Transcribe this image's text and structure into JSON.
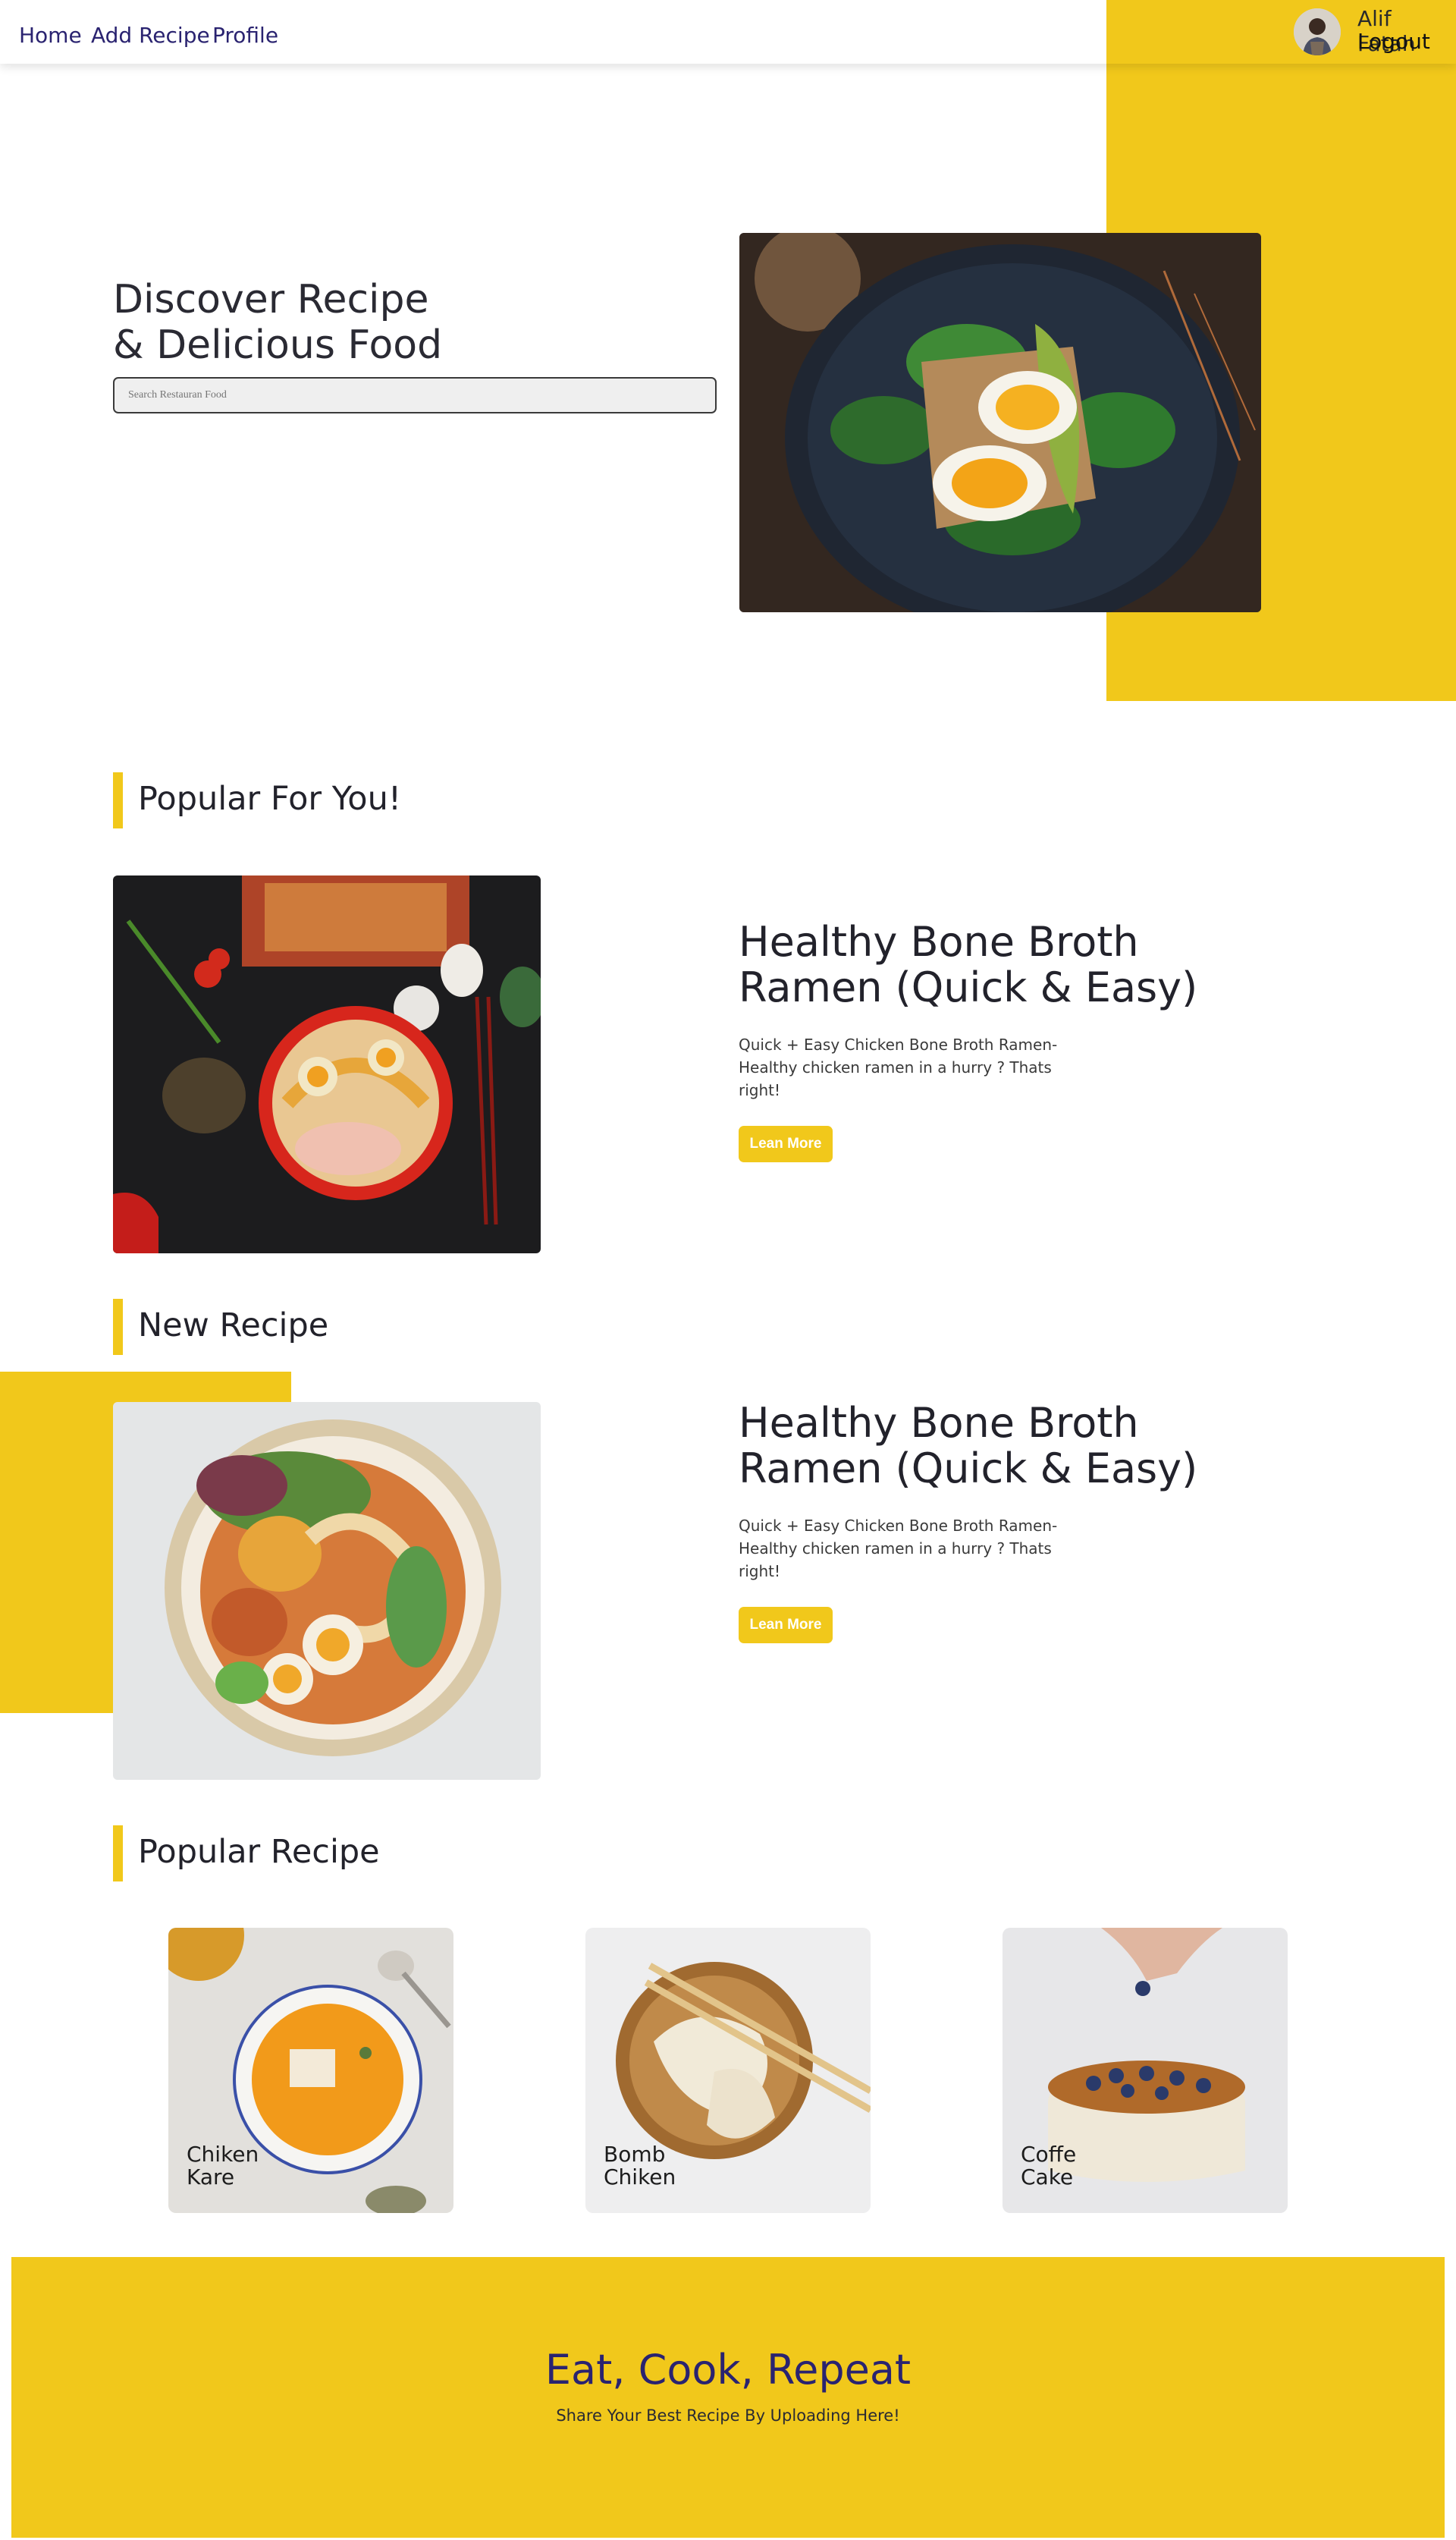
{
  "nav": {
    "items": [
      {
        "label": "Home"
      },
      {
        "label": "Add Recipe"
      },
      {
        "label": "Profile"
      }
    ],
    "user_name": "Alif Fatah",
    "logout_label": "Logout"
  },
  "hero": {
    "title_line1": "Discover Recipe",
    "title_line2": "& Delicious Food",
    "search_placeholder": "Search Restauran Food"
  },
  "popular_for_you": {
    "heading": "Popular For You!",
    "recipe_title_line1": "Healthy Bone Broth",
    "recipe_title_line2": "Ramen (Quick & Easy)",
    "description": "Quick + Easy Chicken Bone Broth Ramen- Healthy chicken ramen in a hurry ? Thats right!",
    "button_label": "Lean More"
  },
  "new_recipe": {
    "heading": "New Recipe",
    "recipe_title_line1": "Healthy Bone Broth",
    "recipe_title_line2": "Ramen (Quick & Easy)",
    "description": "Quick + Easy Chicken Bone Broth Ramen- Healthy chicken ramen in a hurry ? Thats right!",
    "button_label": "Lean More"
  },
  "popular_recipe": {
    "heading": "Popular Recipe",
    "cards": [
      {
        "line1": "Chiken",
        "line2": "Kare"
      },
      {
        "line1": "Bomb",
        "line2": "Chiken"
      },
      {
        "line1": "Coffe",
        "line2": "Cake"
      }
    ]
  },
  "footer": {
    "title": "Eat, Cook, Repeat",
    "subtitle": "Share Your Best Recipe By Uploading Here!"
  },
  "colors": {
    "accent": "#f1c81b",
    "nav_text": "#2a2370",
    "text": "#22222b"
  }
}
